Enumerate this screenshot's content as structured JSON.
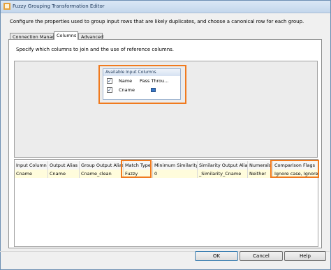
{
  "window": {
    "title": "Fuzzy Grouping Transformation Editor"
  },
  "description": "Configure the properties used to group input rows that are likely duplicates, and choose a canonical row for each group.",
  "tabs": [
    {
      "label": "Connection Manager"
    },
    {
      "label": "Columns"
    },
    {
      "label": "Advanced"
    }
  ],
  "active_tab": "Columns",
  "instruction": "Specify which columns to join and the use of reference columns.",
  "input_columns": {
    "title": "Available Input Columns",
    "headers": {
      "name": "Name",
      "pass": "Pass Throu..."
    },
    "rows": [
      {
        "name": "Cname",
        "checked": true,
        "pass_through": true
      }
    ]
  },
  "grid": {
    "headers": [
      "Input Column",
      "Output Alias",
      "Group Output Alias",
      "Match Type",
      "Minimum Similarity",
      "Similarity Output Alias",
      "Numerals",
      "Comparison Flags"
    ],
    "rows": [
      [
        "Cname",
        "Cname",
        "Cname_clean",
        "Fuzzy",
        "0",
        "_Similarity_Cname",
        "Neither",
        "Ignore case, Ignore ka"
      ]
    ]
  },
  "buttons": {
    "ok": "OK",
    "cancel": "Cancel",
    "help": "Help"
  },
  "colors": {
    "highlight": "#f07a1e",
    "selected_row": "#fffcdc"
  }
}
